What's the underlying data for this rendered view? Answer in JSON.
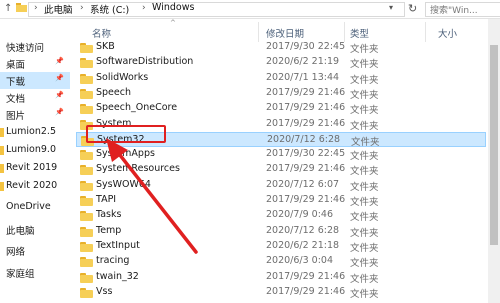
{
  "address": {
    "crumbs": [
      "此电脑",
      "系统 (C:)",
      "Windows"
    ],
    "search_placeholder": "搜索\"Win..."
  },
  "nav": [
    {
      "label": "快速访问",
      "pinned": false
    },
    {
      "label": "桌面",
      "pinned": true
    },
    {
      "label": "下载",
      "pinned": true,
      "selected": true
    },
    {
      "label": "文档",
      "pinned": true
    },
    {
      "label": "图片",
      "pinned": true
    },
    {
      "label": "Lumion2.5",
      "pinned": false
    },
    {
      "label": "Lumion9.0",
      "pinned": false
    },
    {
      "label": "Revit 2019",
      "pinned": false
    },
    {
      "label": "Revit 2020",
      "pinned": false
    },
    {
      "label": "OneDrive",
      "pinned": false
    },
    {
      "label": "此电脑",
      "pinned": false
    },
    {
      "label": "网络",
      "pinned": false
    },
    {
      "label": "家庭组",
      "pinned": false
    }
  ],
  "columns": {
    "name": "名称",
    "date": "修改日期",
    "type": "类型",
    "size": "大小"
  },
  "files": [
    {
      "name": "SKB",
      "date": "2017/9/30 22:45",
      "type": "文件夹"
    },
    {
      "name": "SoftwareDistribution",
      "date": "2020/6/2 21:19",
      "type": "文件夹"
    },
    {
      "name": "SolidWorks",
      "date": "2020/7/1 13:44",
      "type": "文件夹"
    },
    {
      "name": "Speech",
      "date": "2017/9/29 21:46",
      "type": "文件夹"
    },
    {
      "name": "Speech_OneCore",
      "date": "2017/9/29 21:46",
      "type": "文件夹"
    },
    {
      "name": "System",
      "date": "2017/9/29 21:46",
      "type": "文件夹"
    },
    {
      "name": "System32",
      "date": "2020/7/12 6:28",
      "type": "文件夹",
      "selected": true
    },
    {
      "name": "SystemApps",
      "date": "2017/9/30 22:45",
      "type": "文件夹"
    },
    {
      "name": "SystemResources",
      "date": "2017/9/29 21:46",
      "type": "文件夹"
    },
    {
      "name": "SysWOW64",
      "date": "2020/7/12 6:07",
      "type": "文件夹"
    },
    {
      "name": "TAPI",
      "date": "2017/9/29 21:46",
      "type": "文件夹"
    },
    {
      "name": "Tasks",
      "date": "2020/7/9 0:46",
      "type": "文件夹"
    },
    {
      "name": "Temp",
      "date": "2020/7/12 6:28",
      "type": "文件夹"
    },
    {
      "name": "TextInput",
      "date": "2020/6/2 21:18",
      "type": "文件夹"
    },
    {
      "name": "tracing",
      "date": "2020/6/3 0:04",
      "type": "文件夹"
    },
    {
      "name": "twain_32",
      "date": "2017/9/29 21:46",
      "type": "文件夹"
    },
    {
      "name": "Vss",
      "date": "2017/9/29 21:46",
      "type": "文件夹"
    }
  ],
  "colors": {
    "selection": "#cce8ff",
    "annotation": "#e02020",
    "folder": "#f6cf57"
  }
}
